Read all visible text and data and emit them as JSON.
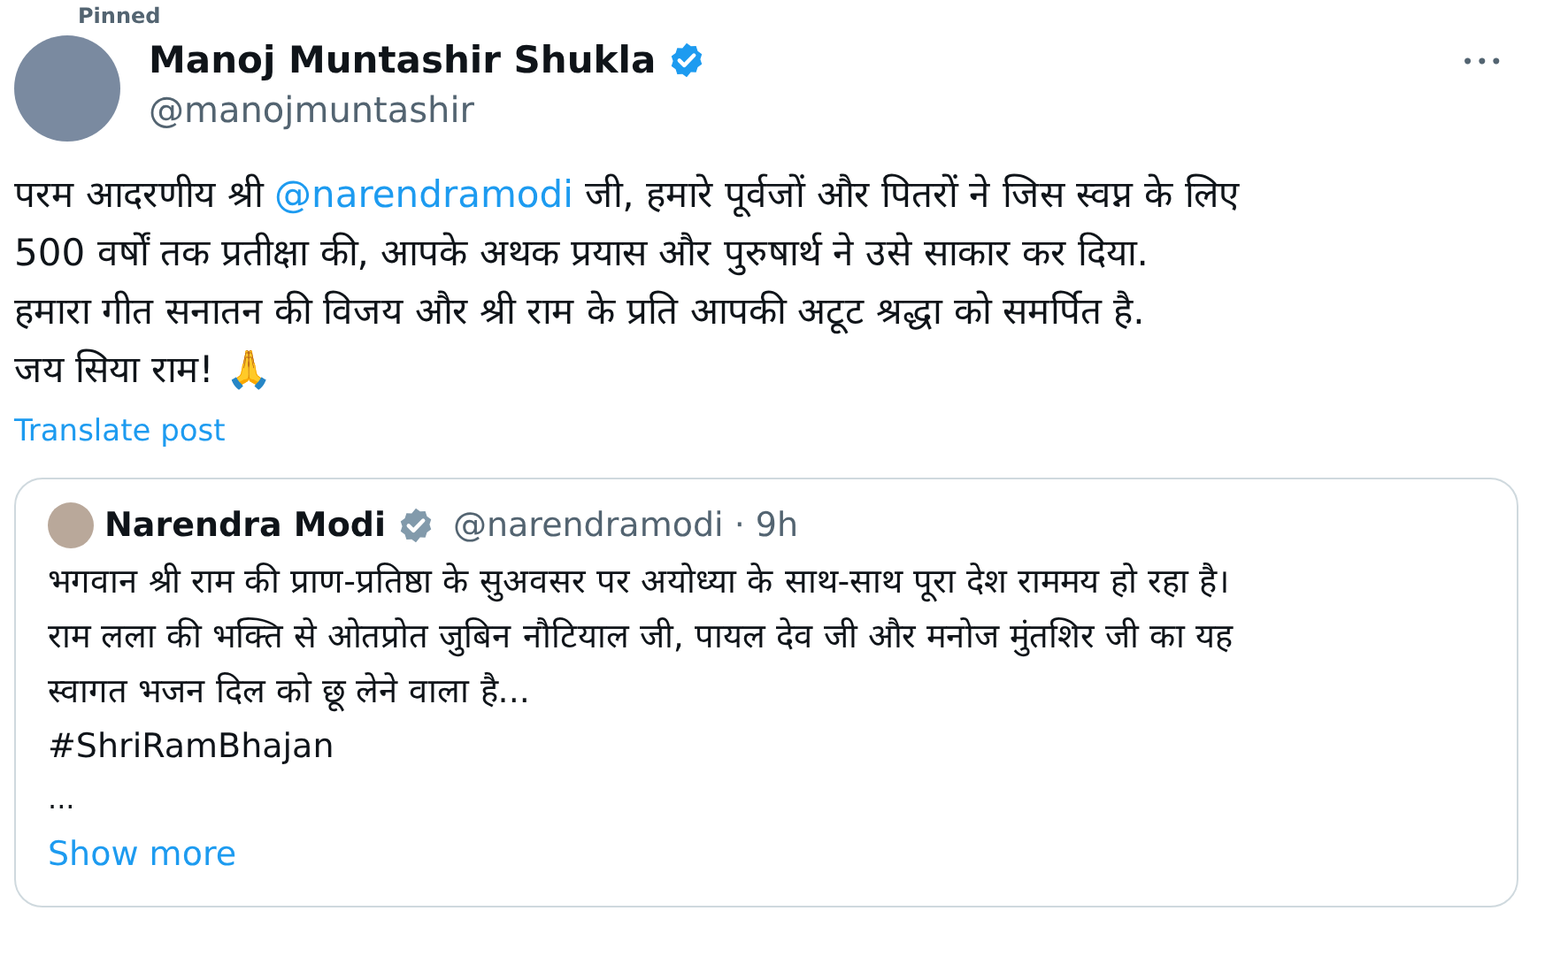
{
  "pinned_label": "Pinned",
  "author": {
    "name": "Manoj Muntashir Shukla",
    "verified": true,
    "handle": "@manojmuntashir"
  },
  "more_button": "•••",
  "post": {
    "text_before": "परम आदरणीय श्री ",
    "mention": "@narendramodi",
    "text_after": " जी, हमारे पूर्वजों और पितरों ने जिस स्वप्न के लिए\n500 वर्षों तक  प्रतीक्षा की, आपके अथक प्रयास और पुरुषार्थ ने उसे साकार कर दिया.\nहमारा गीत सनातन की विजय और श्री राम के प्रति आपकी अटूट श्रद्धा को समर्पित है.\nजय सिया राम! 🙏"
  },
  "translate_link": "Translate post",
  "quote": {
    "name": "Narendra Modi",
    "verified": true,
    "handle": "@narendramodi",
    "separator": "·",
    "time": "9h",
    "text": "भगवान श्री राम की प्राण-प्रतिष्ठा के सुअवसर पर अयोध्या के साथ-साथ पूरा देश राममय हो रहा है।\nराम लला की भक्ति से ओतप्रोत जुबिन नौटियाल जी, पायल देव जी और मनोज मुंतशिर जी का यह\nस्वागत भजन दिल को छू लेने वाला है...",
    "hashtag": "#ShriRamBhajan",
    "ellipsis": "...",
    "show_more": "Show more"
  }
}
